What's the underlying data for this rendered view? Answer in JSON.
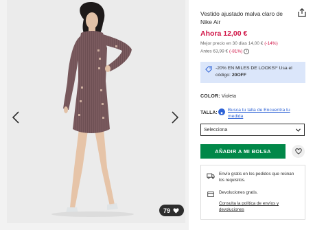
{
  "gallery": {
    "likes_count": "79",
    "icons": {
      "prev": "chevron-left-icon",
      "next": "chevron-right-icon",
      "like": "heart-icon"
    }
  },
  "product": {
    "title": "Vestido ajustado malva claro de Nike Air",
    "price_now": "Ahora 12,00 €",
    "best_price_text": "Mejor precio en 30 días 14,00 €",
    "best_price_pct": "(-14%)",
    "before_text": "Antes 63,99 €",
    "before_pct": "(-81%)",
    "promo_text": "-20% EN MILES DE LOOKS!* Usa el código:",
    "promo_code": "20OFF",
    "color_label": "COLOR:",
    "color_value": "Violeta",
    "size_label": "TALLA:",
    "size_guide": "Busca tu talla de Encuentra tu medida",
    "select_value": "Selecciona",
    "add_to_bag": "AÑADIR A MI BOLSA"
  },
  "delivery": {
    "shipping": "Envío gratis en los pedidos que reúnan los requisitos.",
    "returns": "Devoluciones gratis.",
    "policy_link": "Consulta la política de envíos y devoluciones"
  },
  "colors": {
    "accent_red": "#d01345",
    "add_green": "#018849",
    "promo_bg": "#dbe6fa",
    "link_blue": "#2d62d6",
    "dress": "#7a5a5e"
  }
}
